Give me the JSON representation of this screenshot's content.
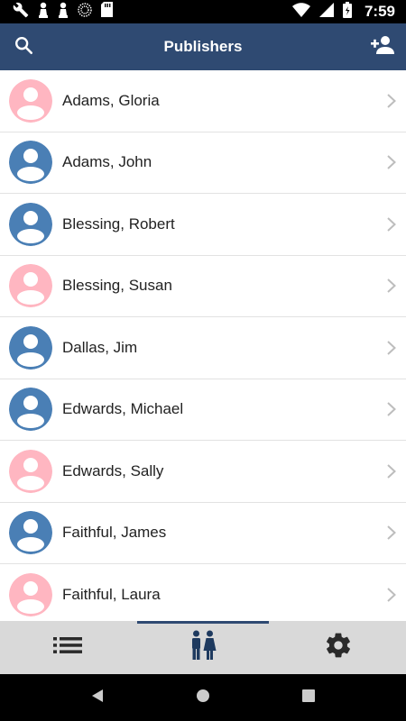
{
  "status_bar": {
    "time": "7:59",
    "left_icons": [
      "wrench-icon",
      "pawn-icon",
      "pawn-icon",
      "sync-icon",
      "sd-card-icon"
    ],
    "right_icons": [
      "wifi-icon",
      "cellular-icon",
      "battery-icon"
    ]
  },
  "app_bar": {
    "title": "Publishers",
    "left_icon": "search-icon",
    "right_icon": "add-person-icon",
    "color": "#2F4A72"
  },
  "publishers": [
    {
      "name": "Adams, Gloria",
      "gender": "female"
    },
    {
      "name": "Adams, John",
      "gender": "male"
    },
    {
      "name": "Blessing, Robert",
      "gender": "male"
    },
    {
      "name": "Blessing, Susan",
      "gender": "female"
    },
    {
      "name": "Dallas, Jim",
      "gender": "male"
    },
    {
      "name": "Edwards, Michael",
      "gender": "male"
    },
    {
      "name": "Edwards, Sally",
      "gender": "female"
    },
    {
      "name": "Faithful, James",
      "gender": "male"
    },
    {
      "name": "Faithful, Laura",
      "gender": "female"
    }
  ],
  "avatar_colors": {
    "male": "#4A7FB5",
    "female": "#FFB6C1"
  },
  "bottom_nav": {
    "items": [
      "list-icon",
      "people-icon",
      "settings-gear-icon"
    ],
    "selected_index": 1
  },
  "system_nav": [
    "back-icon",
    "home-icon",
    "recents-icon"
  ]
}
